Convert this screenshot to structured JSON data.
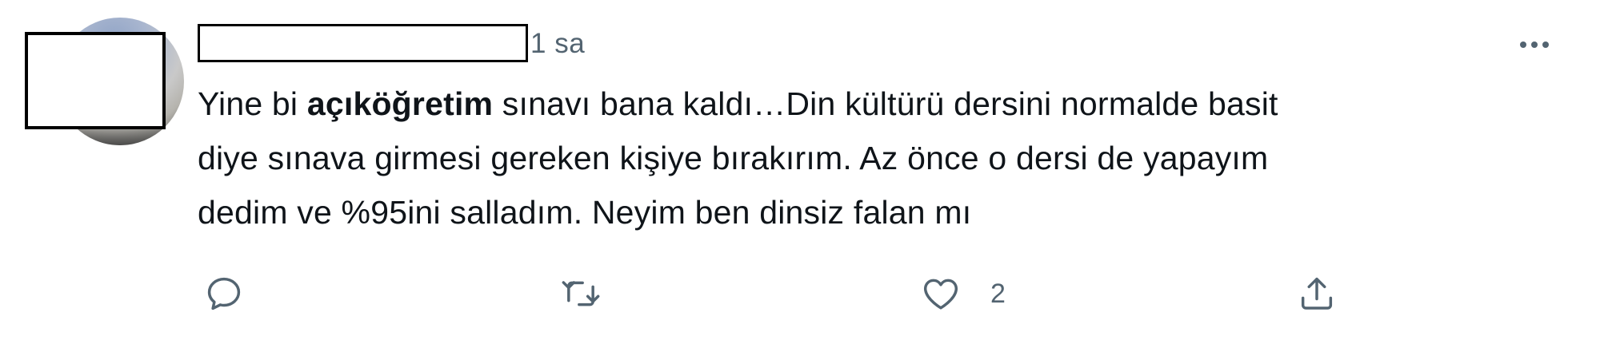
{
  "tweet": {
    "time": "1 sa",
    "text_lines": [
      {
        "before": "Yine bi ",
        "bold": "açıköğretim",
        "after": " sınavı bana kaldı…Din kültürü dersini normalde basit"
      },
      {
        "text": "diye sınava girmesi gereken kişiye bırakırım. Az önce o dersi de yapayım"
      },
      {
        "text": "dedim ve %95ini salladım. Neyim ben dinsiz falan mı"
      }
    ],
    "like_count": "2"
  },
  "icons": {
    "more": "more-horizontal-icon",
    "reply": "reply-icon",
    "retweet": "retweet-icon",
    "like": "heart-icon",
    "share": "share-icon"
  },
  "colors": {
    "text": "#0f1419",
    "secondary": "#536471",
    "background": "#ffffff",
    "redaction_border": "#000000"
  }
}
